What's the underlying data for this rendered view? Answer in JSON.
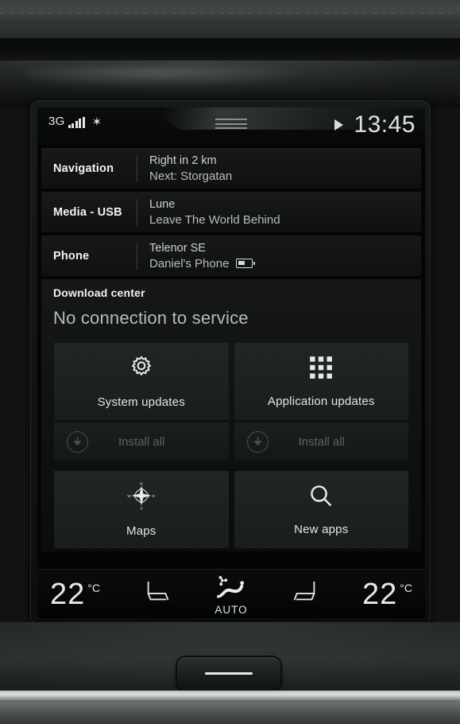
{
  "statusbar": {
    "network_label": "3G",
    "signal_bars": 5,
    "bluetooth_icon": "✶",
    "bluetooth_icon_name": "bluetooth-icon",
    "play_icon_name": "play-icon",
    "clock": "13:45",
    "handle_icon_name": "drag-handle-icon"
  },
  "page_indicator": {
    "total": 3,
    "active_index": 1
  },
  "cards": [
    {
      "label": "Navigation",
      "line1": "Right in 2 km",
      "line2": "Next: Storgatan",
      "has_battery": false
    },
    {
      "label": "Media - USB",
      "line1": "Lune",
      "line2": "Leave The World Behind",
      "has_battery": false
    },
    {
      "label": "Phone",
      "line1": "Telenor SE",
      "line2": "Daniel's Phone",
      "has_battery": true
    }
  ],
  "download_center": {
    "title": "Download center",
    "status": "No connection to service",
    "tiles_row1": [
      {
        "label": "System updates",
        "icon": "gear-icon"
      },
      {
        "label": "Application updates",
        "icon": "app-grid-icon"
      }
    ],
    "install_buttons": [
      {
        "label": "Install all",
        "icon": "download-circle-icon",
        "disabled": true
      },
      {
        "label": "Install all",
        "icon": "download-circle-icon",
        "disabled": true
      }
    ],
    "tiles_row2": [
      {
        "label": "Maps",
        "icon": "compass-icon"
      },
      {
        "label": "New apps",
        "icon": "search-icon"
      }
    ]
  },
  "climate": {
    "left_temperature": "22",
    "left_unit": "°C",
    "left_seat_icon": "seat-heater-icon",
    "center_mode": "AUTO",
    "center_icon": "climate-auto-fan-icon",
    "right_seat_icon": "seat-heater-icon",
    "right_temperature": "22",
    "right_unit": "°C"
  },
  "colors": {
    "screen_bg": "#050505",
    "card_bg": "#17191a",
    "tile_bg": "#222526",
    "text_primary": "#f2f4f4",
    "text_secondary": "#b9bdbd",
    "text_disabled": "#5d6364"
  }
}
